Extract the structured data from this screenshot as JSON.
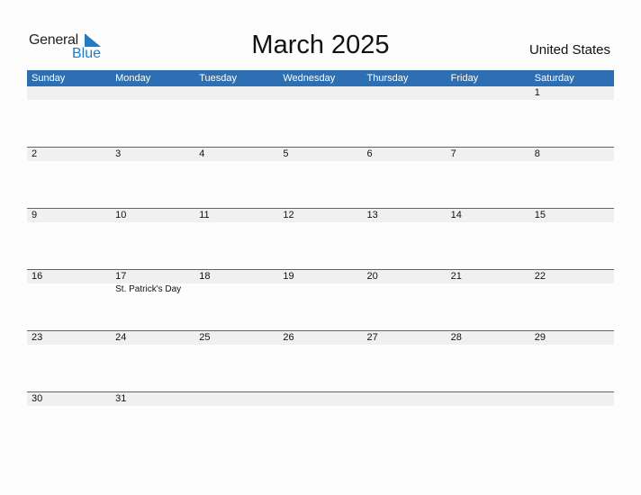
{
  "logo": {
    "line1": "General",
    "line2": "Blue"
  },
  "title": "March 2025",
  "country": "United States",
  "colors": {
    "accent": "#2d6fb2",
    "logo_blue": "#1e7bc5",
    "date_strip": "#f0f0f0"
  },
  "weekdays": [
    "Sunday",
    "Monday",
    "Tuesday",
    "Wednesday",
    "Thursday",
    "Friday",
    "Saturday"
  ],
  "weeks": [
    [
      {
        "d": ""
      },
      {
        "d": ""
      },
      {
        "d": ""
      },
      {
        "d": ""
      },
      {
        "d": ""
      },
      {
        "d": ""
      },
      {
        "d": "1"
      }
    ],
    [
      {
        "d": "2"
      },
      {
        "d": "3"
      },
      {
        "d": "4"
      },
      {
        "d": "5"
      },
      {
        "d": "6"
      },
      {
        "d": "7"
      },
      {
        "d": "8"
      }
    ],
    [
      {
        "d": "9"
      },
      {
        "d": "10"
      },
      {
        "d": "11"
      },
      {
        "d": "12"
      },
      {
        "d": "13"
      },
      {
        "d": "14"
      },
      {
        "d": "15"
      }
    ],
    [
      {
        "d": "16"
      },
      {
        "d": "17",
        "event": "St. Patrick's Day"
      },
      {
        "d": "18"
      },
      {
        "d": "19"
      },
      {
        "d": "20"
      },
      {
        "d": "21"
      },
      {
        "d": "22"
      }
    ],
    [
      {
        "d": "23"
      },
      {
        "d": "24"
      },
      {
        "d": "25"
      },
      {
        "d": "26"
      },
      {
        "d": "27"
      },
      {
        "d": "28"
      },
      {
        "d": "29"
      }
    ],
    [
      {
        "d": "30"
      },
      {
        "d": "31"
      },
      {
        "d": ""
      },
      {
        "d": ""
      },
      {
        "d": ""
      },
      {
        "d": ""
      },
      {
        "d": ""
      }
    ]
  ]
}
